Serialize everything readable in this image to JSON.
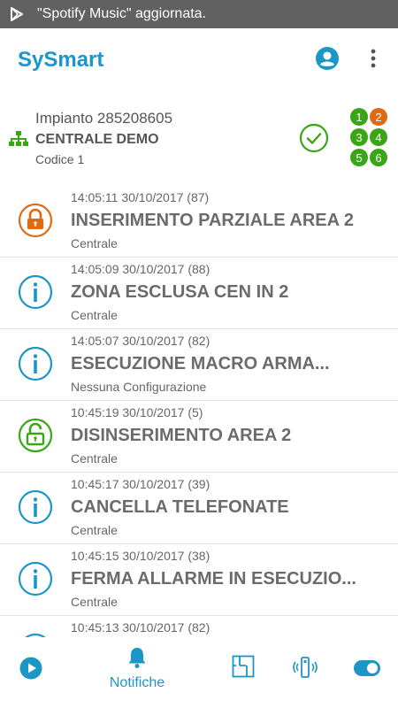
{
  "status_bar": {
    "notification_text": "\"Spotify Music\" aggiornata."
  },
  "app_bar": {
    "title": "SySmart",
    "account_icon": "account-circle-icon",
    "more_icon": "more-vert-icon"
  },
  "system": {
    "line1": "Impianto 285208605",
    "line2": "CENTRALE DEMO",
    "line3": "Codice 1",
    "status_icon": "check-circle-icon",
    "areas": [
      {
        "label": "1",
        "color": "#3aa517"
      },
      {
        "label": "2",
        "color": "#e06a12"
      },
      {
        "label": "3",
        "color": "#3aa517"
      },
      {
        "label": "4",
        "color": "#3aa517"
      },
      {
        "label": "5",
        "color": "#3aa517"
      },
      {
        "label": "6",
        "color": "#3aa517"
      }
    ]
  },
  "events": [
    {
      "time": "14:05:11 30/10/2017 (87)",
      "title": "INSERIMENTO PARZIALE AREA 2",
      "source": "Centrale",
      "icon": "lock-closed-icon"
    },
    {
      "time": "14:05:09 30/10/2017 (88)",
      "title": "ZONA ESCLUSA CEN IN 2",
      "source": "Centrale",
      "icon": "info-icon"
    },
    {
      "time": "14:05:07 30/10/2017 (82)",
      "title": "ESECUZIONE MACRO ARMA...",
      "source": "Nessuna Configurazione",
      "icon": "info-icon"
    },
    {
      "time": "10:45:19 30/10/2017 (5)",
      "title": "DISINSERIMENTO AREA 2",
      "source": "Centrale",
      "icon": "lock-open-icon"
    },
    {
      "time": "10:45:17 30/10/2017 (39)",
      "title": "CANCELLA TELEFONATE",
      "source": "Centrale",
      "icon": "info-icon"
    },
    {
      "time": "10:45:15 30/10/2017 (38)",
      "title": "FERMA ALLARME IN ESECUZIO...",
      "source": "Centrale",
      "icon": "info-icon"
    },
    {
      "time": "10:45:13 30/10/2017 (82)",
      "title": "",
      "source": "",
      "icon": "info-icon"
    }
  ],
  "bottom_nav": {
    "items": [
      {
        "icon": "play-circle-icon",
        "label": ""
      },
      {
        "icon": "bell-icon",
        "label": "Notifiche"
      },
      {
        "icon": "floor-plan-icon",
        "label": ""
      },
      {
        "icon": "remote-signal-icon",
        "label": ""
      },
      {
        "icon": "toggle-icon",
        "label": ""
      }
    ]
  },
  "colors": {
    "accent": "#1a96c7",
    "ok_green": "#3aa517",
    "alert_orange": "#e06a12",
    "status_bar": "#616161"
  }
}
